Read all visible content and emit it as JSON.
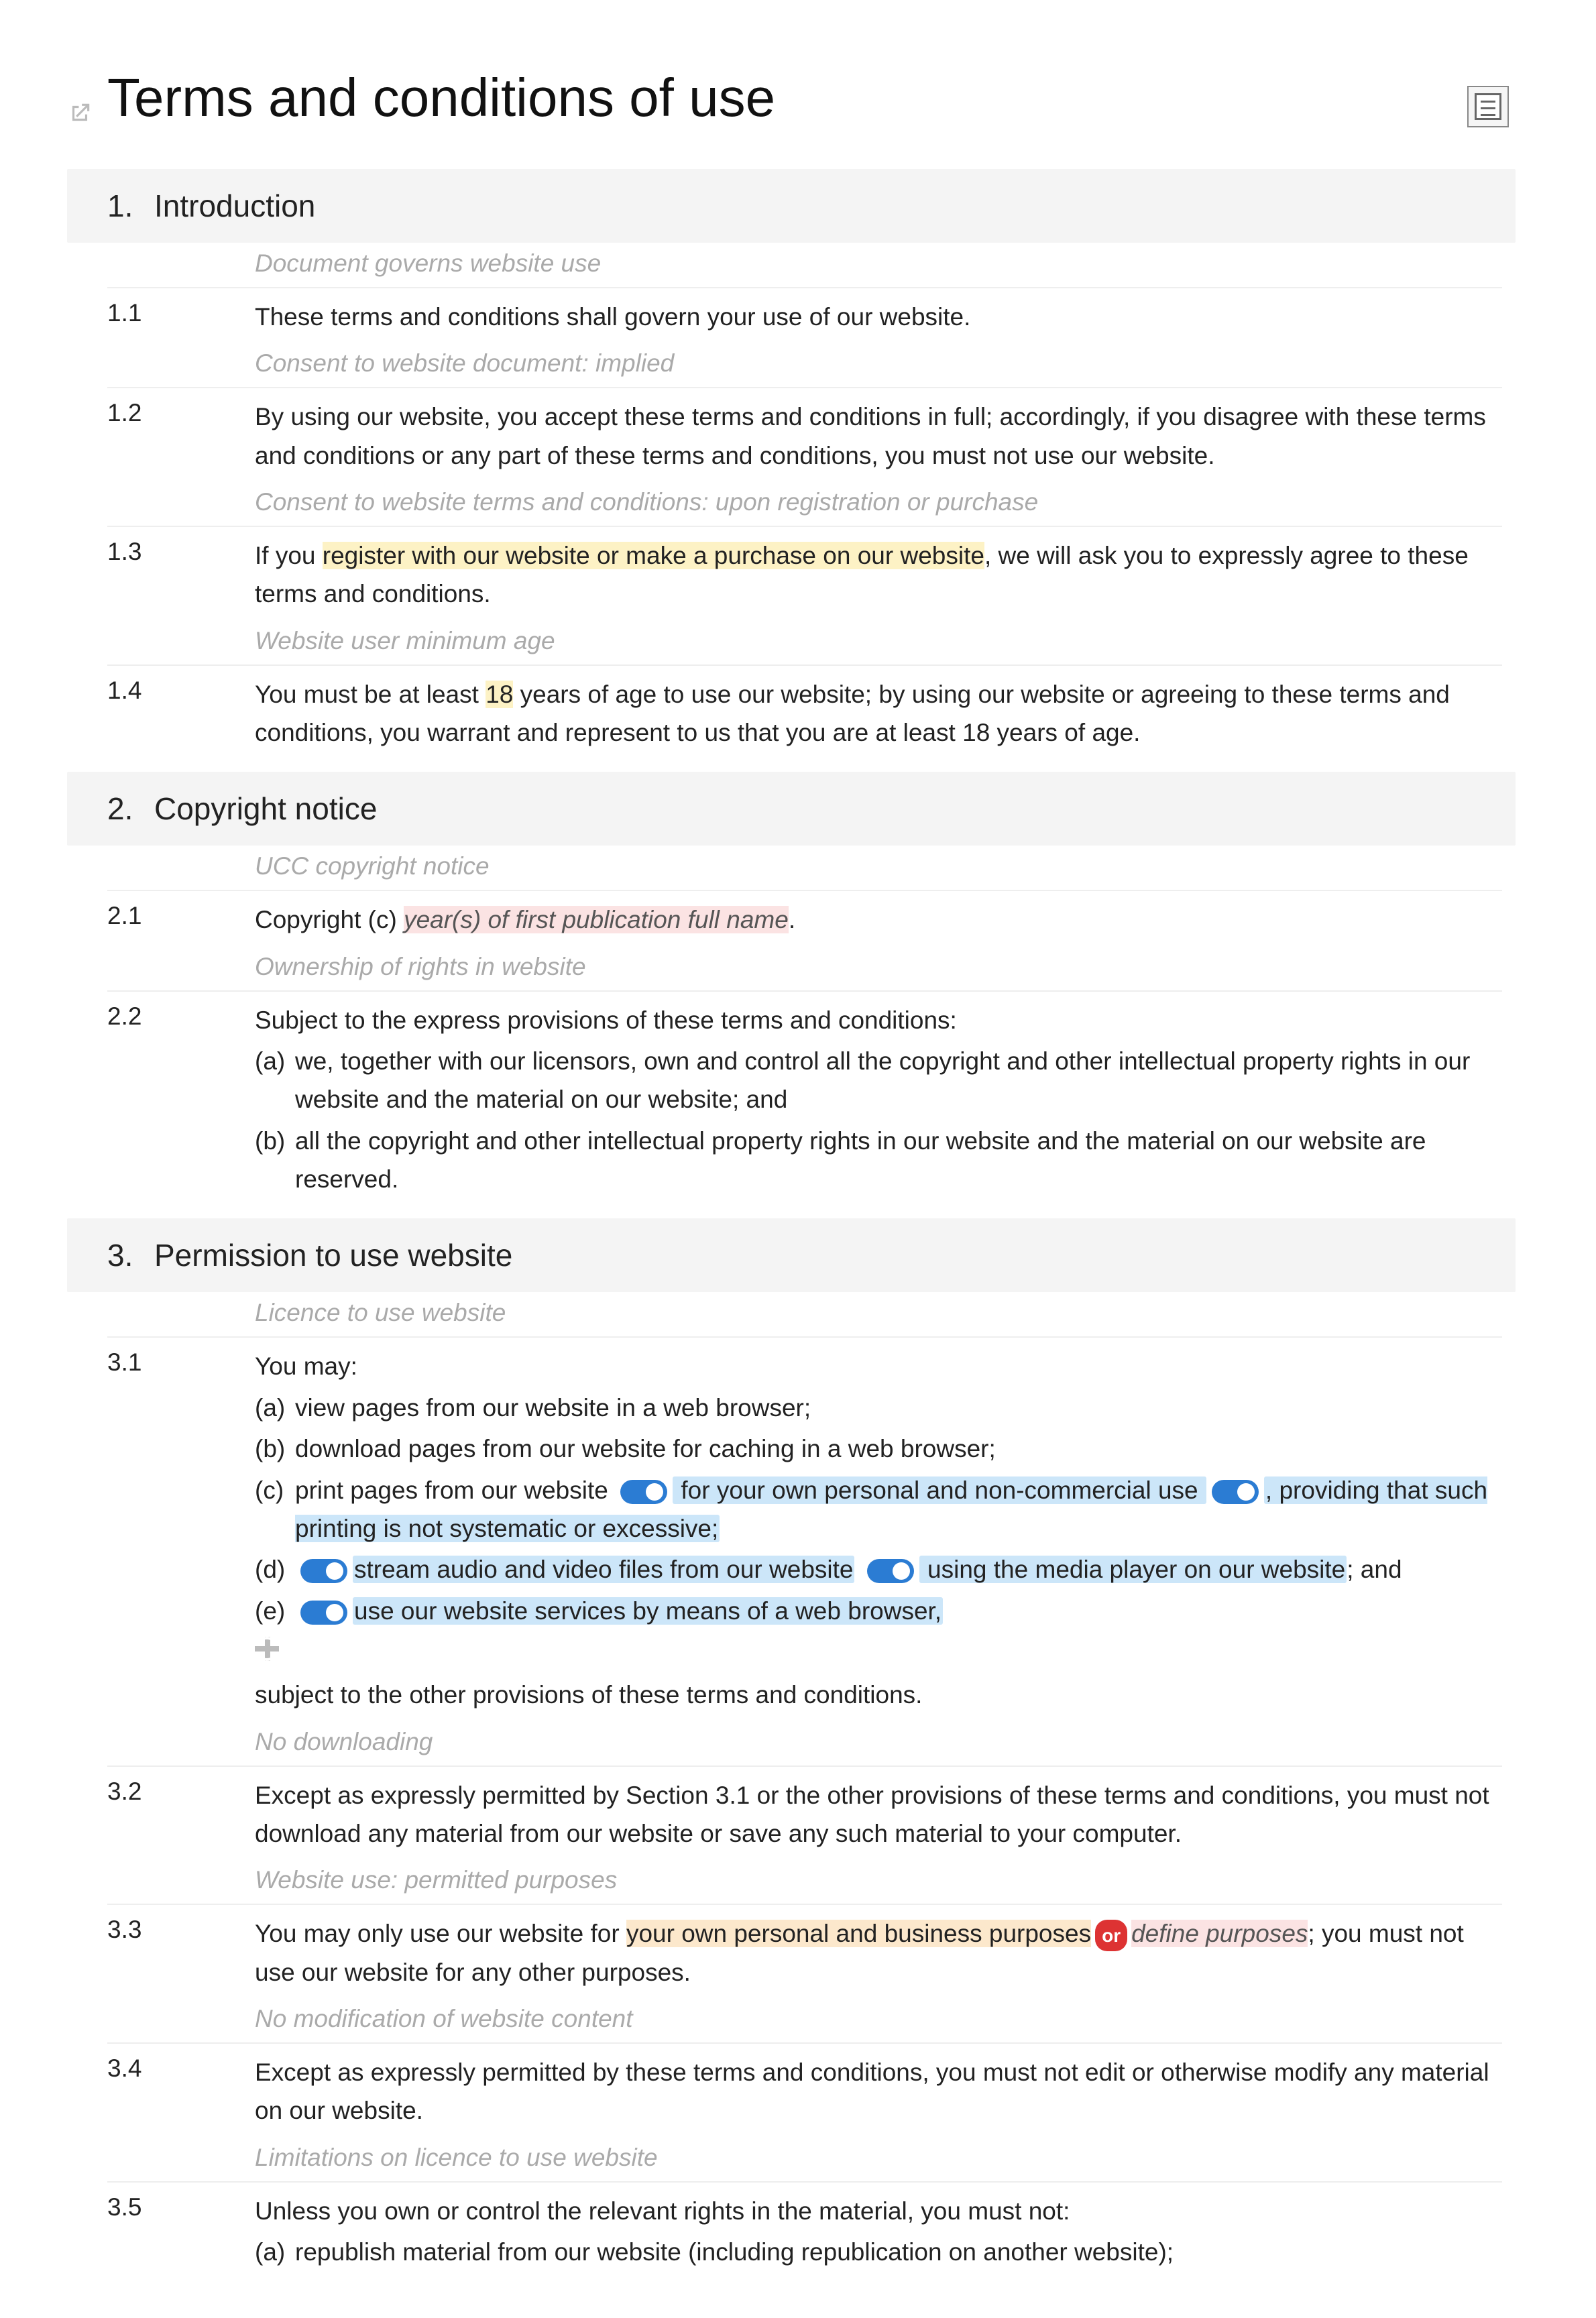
{
  "title": "Terms and conditions of use",
  "sections": [
    {
      "num": "1.",
      "title": "Introduction",
      "items": [
        {
          "annot": "Document governs website use",
          "num": "1.1",
          "pre": "These terms and conditions shall govern your use of our website."
        },
        {
          "annot": "Consent to website document: implied",
          "num": "1.2",
          "pre": "By using our website, you accept these terms and conditions in full; accordingly, if you disagree with these terms and conditions or any part of these terms and conditions, you must not use our website."
        },
        {
          "annot": "Consent to website terms and conditions: upon registration or purchase",
          "num": "1.3",
          "pre": "If you ",
          "hl_yellow": "register with our website or make a purchase on our website",
          "post": ", we will ask you to expressly agree to these terms and conditions."
        },
        {
          "annot": "Website user minimum age",
          "num": "1.4",
          "pre": "You must be at least ",
          "hl_yellow2": "18",
          "post2": " years of age to use our website; by using our website or agreeing to these terms and conditions, you warrant and represent to us that you are at least 18 years of age."
        }
      ]
    },
    {
      "num": "2.",
      "title": "Copyright notice",
      "items": [
        {
          "annot": "UCC copyright notice",
          "num": "2.1",
          "pre": "Copyright (c) ",
          "hl_pink": "year(s) of first publication full name",
          "post": "."
        },
        {
          "annot": "Ownership of rights in website",
          "num": "2.2",
          "pre": "Subject to the express provisions of these terms and conditions:",
          "subs": [
            {
              "l": "(a)",
              "t": "we, together with our licensors, own and control all the copyright and other intellectual property rights in our website and the material on our website; and"
            },
            {
              "l": "(b)",
              "t": "all the copyright and other intellectual property rights in our website and the material on our website are reserved."
            }
          ]
        }
      ]
    },
    {
      "num": "3.",
      "title": "Permission to use website",
      "items": [
        {
          "annot": "Licence to use website",
          "num": "3.1",
          "pre": "You may:",
          "subs_custom": true,
          "sub_a": {
            "l": "(a)",
            "t": "view pages from our website in a web browser;"
          },
          "sub_b": {
            "l": "(b)",
            "t": "download pages from our website for caching in a web browser;"
          },
          "sub_c": {
            "l": "(c)",
            "t1": "print pages from our website",
            "blue1": " for your own personal and non-commercial use ",
            "blue2": ", providing that such printing is not systematic or excessive;"
          },
          "sub_d": {
            "l": "(d)",
            "blue1": "stream audio and video files from our website",
            "blue2": " using the media player on our website",
            "t2": "; and"
          },
          "sub_e": {
            "l": "(e)",
            "blue1": "use our website services by means of a web browser,",
            "t2": ""
          },
          "tail": "subject to the other provisions of these terms and conditions."
        },
        {
          "annot": "No downloading",
          "num": "3.2",
          "pre": "Except as expressly permitted by Section 3.1 or the other provisions of these terms and conditions, you must not download any material from our website or save any such material to your computer."
        },
        {
          "annot": "Website use: permitted purposes",
          "num": "3.3",
          "pre": "You may only use our website for ",
          "hl_orange": "your own personal and business purposes",
          "or_pill": "or",
          "hl_pink": "define purposes",
          "post": "; you must not use our website for any other purposes."
        },
        {
          "annot": "No modification of website content",
          "num": "3.4",
          "pre": "Except as expressly permitted by these terms and conditions, you must not edit or otherwise modify any material on our website."
        },
        {
          "annot": "Limitations on licence to use website",
          "num": "3.5",
          "pre": "Unless you own or control the relevant rights in the material, you must not:",
          "subs": [
            {
              "l": "(a)",
              "t": "republish material from our website (including republication on another website);"
            }
          ]
        }
      ]
    }
  ]
}
